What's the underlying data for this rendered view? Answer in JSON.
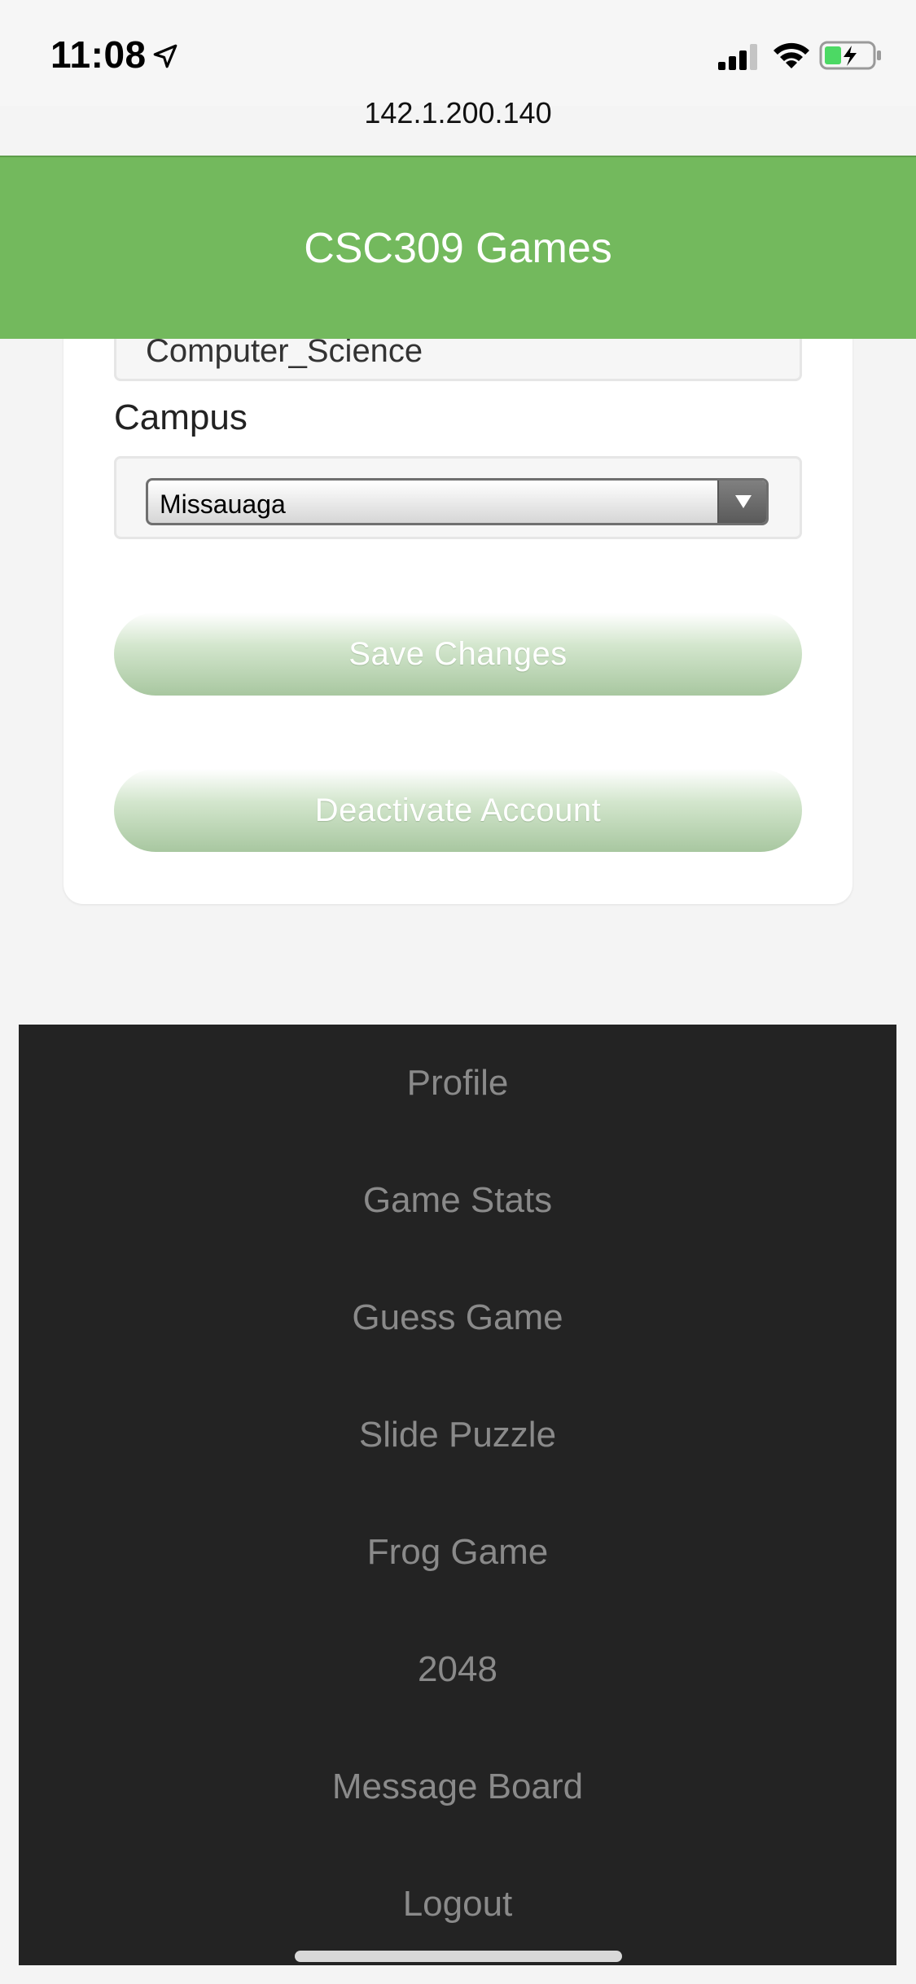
{
  "status_bar": {
    "time": "11:08",
    "url": "142.1.200.140"
  },
  "header": {
    "title": "CSC309 Games",
    "color": "#73b95d"
  },
  "form": {
    "program_value": "Computer_Science",
    "campus_label": "Campus",
    "campus_selected": "Missauaga",
    "save_button": "Save Changes",
    "deactivate_button": "Deactivate Account"
  },
  "nav": {
    "items": [
      "Profile",
      "Game Stats",
      "Guess Game",
      "Slide Puzzle",
      "Frog Game",
      "2048",
      "Message Board",
      "Logout"
    ]
  },
  "icons": {
    "location": "location-arrow-icon",
    "signal": "cellular-signal-icon",
    "wifi": "wifi-icon",
    "battery": "battery-charging-icon"
  }
}
